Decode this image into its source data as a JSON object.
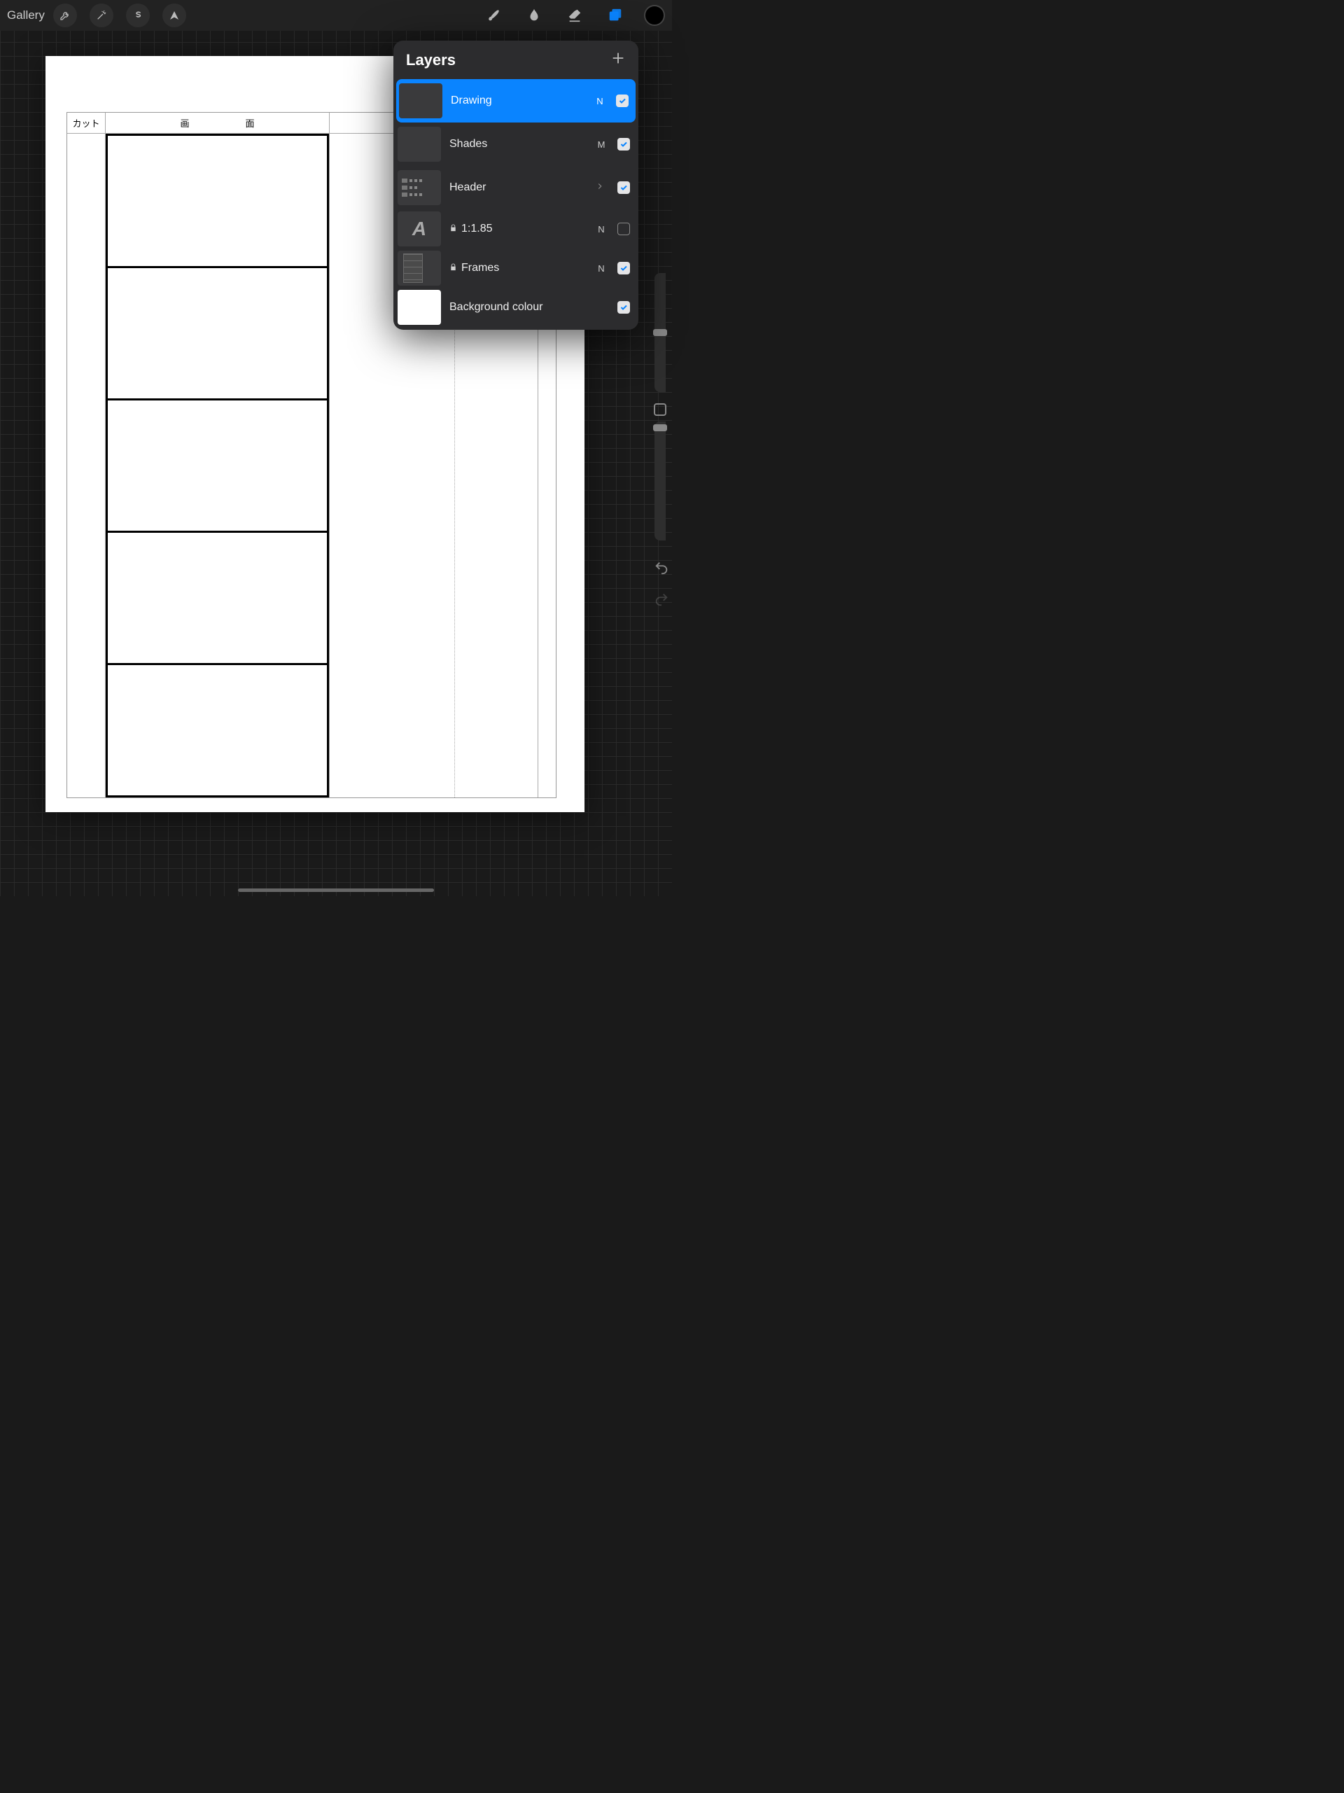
{
  "toolbar": {
    "gallery_label": "Gallery"
  },
  "canvas": {
    "col1_header": "カット",
    "col2_header": "画面"
  },
  "layers_panel": {
    "title": "Layers"
  },
  "layers": [
    {
      "name": "Drawing",
      "blend": "N",
      "checked": true,
      "selected": true,
      "locked": false,
      "thumb": "gray"
    },
    {
      "name": "Shades",
      "blend": "M",
      "checked": true,
      "selected": false,
      "locked": false,
      "thumb": "gray"
    },
    {
      "name": "Header",
      "blend": "",
      "checked": true,
      "selected": false,
      "locked": false,
      "group": true,
      "thumb": "header"
    },
    {
      "name": "1:1.85",
      "blend": "N",
      "checked": false,
      "selected": false,
      "locked": true,
      "thumb": "ratio"
    },
    {
      "name": "Frames",
      "blend": "N",
      "checked": true,
      "selected": false,
      "locked": true,
      "thumb": "frames"
    },
    {
      "name": "Background colour",
      "blend": "",
      "checked": true,
      "selected": false,
      "locked": false,
      "thumb": "white"
    }
  ]
}
